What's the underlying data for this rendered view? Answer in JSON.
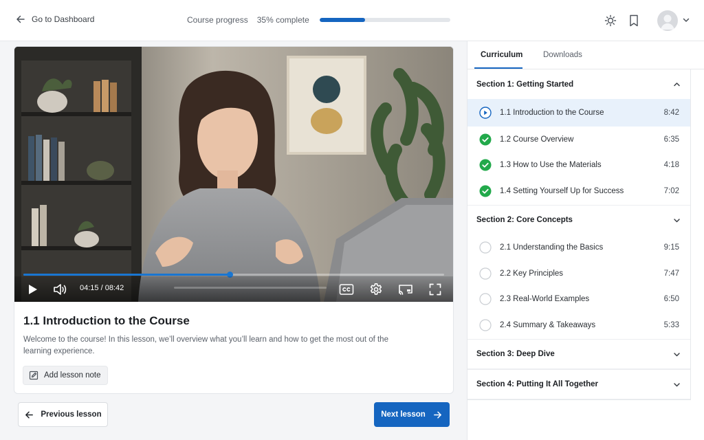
{
  "header": {
    "back_label": "Go to Dashboard",
    "progress_label": "Course progress",
    "progress_text": "35% complete",
    "progress_value": 0.35
  },
  "video": {
    "time_display": "04:15 / 08:42",
    "position_fraction": 0.49
  },
  "lesson": {
    "title": "1.1 Introduction to the Course",
    "description": "Welcome to the course! In this lesson, we’ll overview what you’ll learn and how to get the most out of the learning experience.",
    "add_note_label": "Add lesson note"
  },
  "nav": {
    "prev_label": "Previous lesson",
    "next_label": "Next lesson"
  },
  "tabs": [
    {
      "label": "Curriculum",
      "active": true
    },
    {
      "label": "Downloads",
      "active": false
    }
  ],
  "sections": [
    {
      "title": "Section 1: Getting Started",
      "expanded": true,
      "lessons": [
        {
          "title": "1.1 Introduction to the Course",
          "duration": "8:42",
          "status": "playing"
        },
        {
          "title": "1.2 Course Overview",
          "duration": "6:35",
          "status": "done"
        },
        {
          "title": "1.3 How to Use the Materials",
          "duration": "4:18",
          "status": "done"
        },
        {
          "title": "1.4 Setting Yourself Up for Success",
          "duration": "7:02",
          "status": "done"
        }
      ]
    },
    {
      "title": "Section 2: Core Concepts",
      "expanded": true,
      "lessons": [
        {
          "title": "2.1 Understanding the Basics",
          "duration": "9:15",
          "status": "todo"
        },
        {
          "title": "2.2 Key Principles",
          "duration": "7:47",
          "status": "todo"
        },
        {
          "title": "2.3 Real-World Examples",
          "duration": "6:50",
          "status": "todo"
        },
        {
          "title": "2.4 Summary & Takeaways",
          "duration": "5:33",
          "status": "todo"
        }
      ]
    },
    {
      "title": "Section 3: Deep Dive",
      "expanded": false,
      "lessons": []
    },
    {
      "title": "Section 4: Putting It All Together",
      "expanded": false,
      "lessons": []
    }
  ],
  "colors": {
    "accent": "#1565c0",
    "check": "#22a94b",
    "active_row": "#e8f1fb"
  }
}
